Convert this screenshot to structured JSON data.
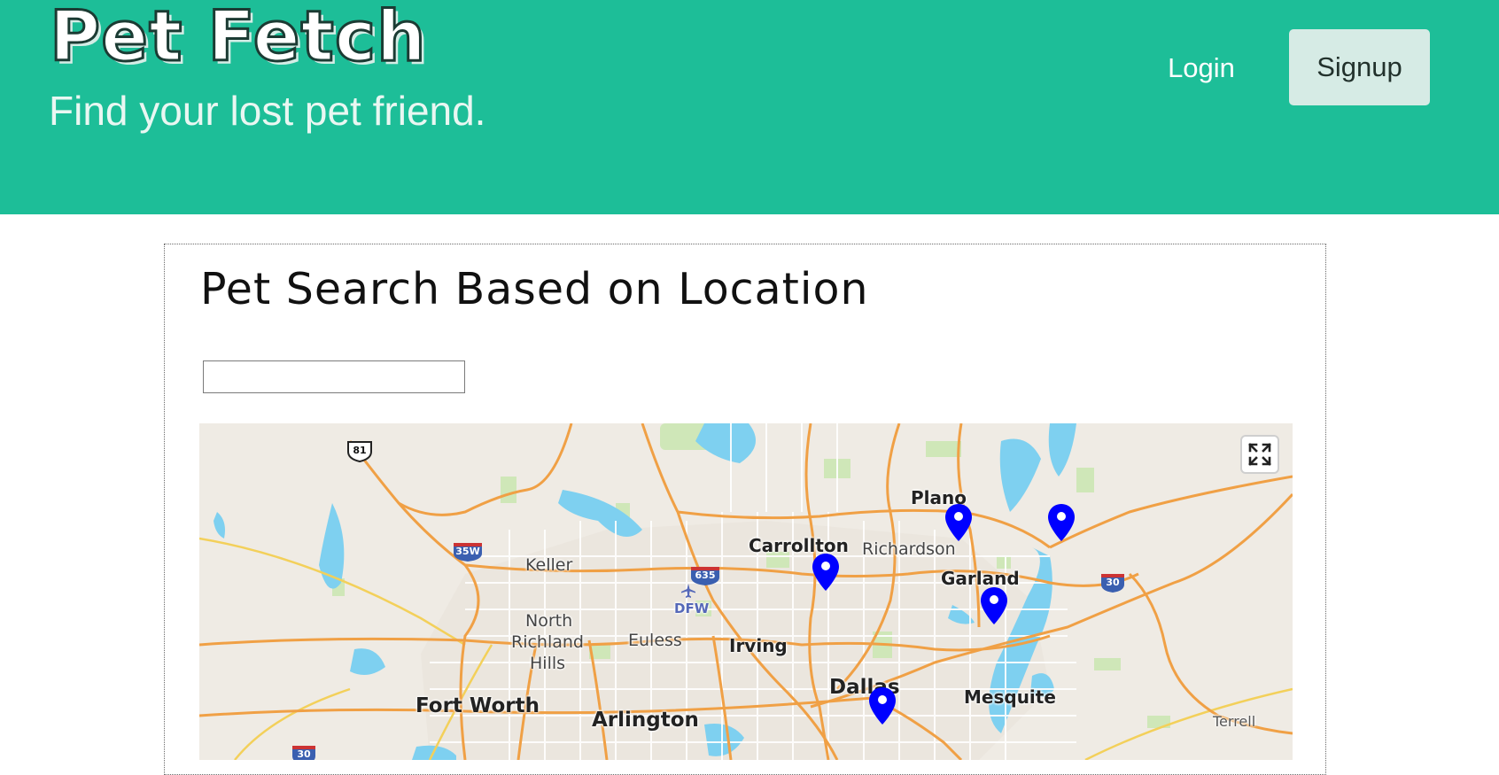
{
  "header": {
    "brand": "Pet Fetch",
    "tagline": "Find your lost pet friend.",
    "login_label": "Login",
    "signup_label": "Signup",
    "background_color": "#1dbe98"
  },
  "search": {
    "heading": "Pet Search Based on Location",
    "input_value": "",
    "input_placeholder": ""
  },
  "map": {
    "fullscreen_icon": "expand-icon",
    "pin_color": "#0000ff",
    "cities": {
      "plano": "Plano",
      "carrollton": "Carrollton",
      "richardson": "Richardson",
      "garland": "Garland",
      "keller": "Keller",
      "north_richland": "North",
      "north_richland_2": "Richland",
      "north_richland_3": "Hills",
      "euless": "Euless",
      "irving": "Irving",
      "dallas": "Dallas",
      "mesquite": "Mesquite",
      "fort_worth": "Fort Worth",
      "arlington": "Arlington",
      "terrell": "Terrell",
      "dfw": "DFW"
    },
    "shields": {
      "us81": "81",
      "i35w": "35W",
      "i635": "635",
      "i30_east": "30",
      "i30_west": "30"
    }
  }
}
